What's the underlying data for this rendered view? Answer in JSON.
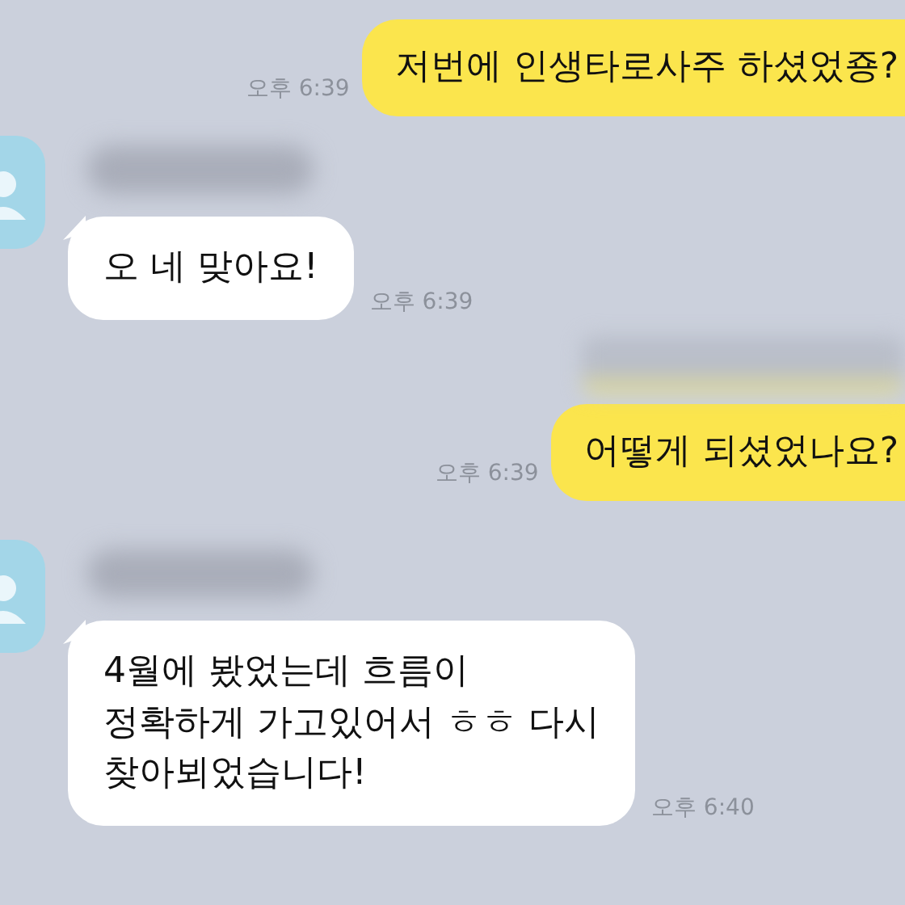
{
  "messages": [
    {
      "kind": "sent",
      "text": "저번에 인생타로사주 하셨었죵?",
      "time": "오후 6:39",
      "hidden_above": false
    },
    {
      "kind": "received",
      "text": "오 네 맞아요!",
      "time": "오후 6:39",
      "hidden_above": true
    },
    {
      "kind": "sent",
      "text": "어떻게 되셨었나요?",
      "time": "오후 6:39",
      "hidden_above": true
    },
    {
      "kind": "received",
      "text": "4월에 봤었는데 흐름이\n정확하게 가고있어서 ㅎㅎ 다시\n찾아뵈었습니다!",
      "time": "오후 6:40",
      "hidden_above": true
    }
  ]
}
